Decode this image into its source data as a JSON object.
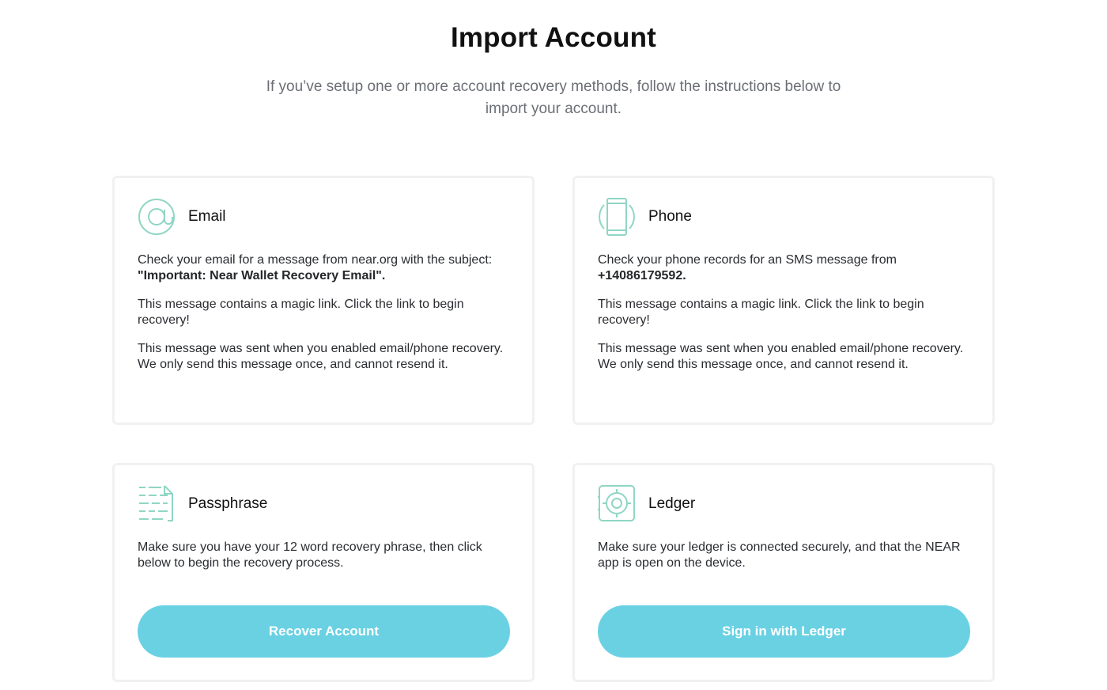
{
  "page": {
    "title": "Import Account",
    "subtitle": "If you’ve setup one or more account recovery methods, follow the instructions below to import your account."
  },
  "colors": {
    "accent_icon": "#8fd6c4",
    "button_bg": "#6ad1e3",
    "card_border": "#f1f1f1"
  },
  "cards": {
    "email": {
      "icon": "at-sign-icon",
      "title": "Email",
      "p1_prefix": "Check your email for a message from near.org with the subject: ",
      "p1_strong": "\"Important: Near Wallet Recovery Email\".",
      "p2": "This message contains a magic link. Click the link to begin recovery!",
      "p3": "This message was sent when you enabled email/phone recovery. We only send this message once, and cannot resend it."
    },
    "phone": {
      "icon": "phone-icon",
      "title": "Phone",
      "p1_prefix": "Check your phone records for an SMS message from ",
      "p1_strong": "+14086179592.",
      "p2": "This message contains a magic link. Click the link to begin recovery!",
      "p3": "This message was sent when you enabled email/phone recovery. We only send this message once, and cannot resend it."
    },
    "passphrase": {
      "icon": "document-lines-icon",
      "title": "Passphrase",
      "text": "Make sure you have your 12 word recovery phrase, then click below to begin the recovery process.",
      "button_label": "Recover Account"
    },
    "ledger": {
      "icon": "ledger-safe-icon",
      "title": "Ledger",
      "text": "Make sure your ledger is connected securely, and that the NEAR app is open on the device.",
      "button_label": "Sign in with Ledger"
    }
  }
}
